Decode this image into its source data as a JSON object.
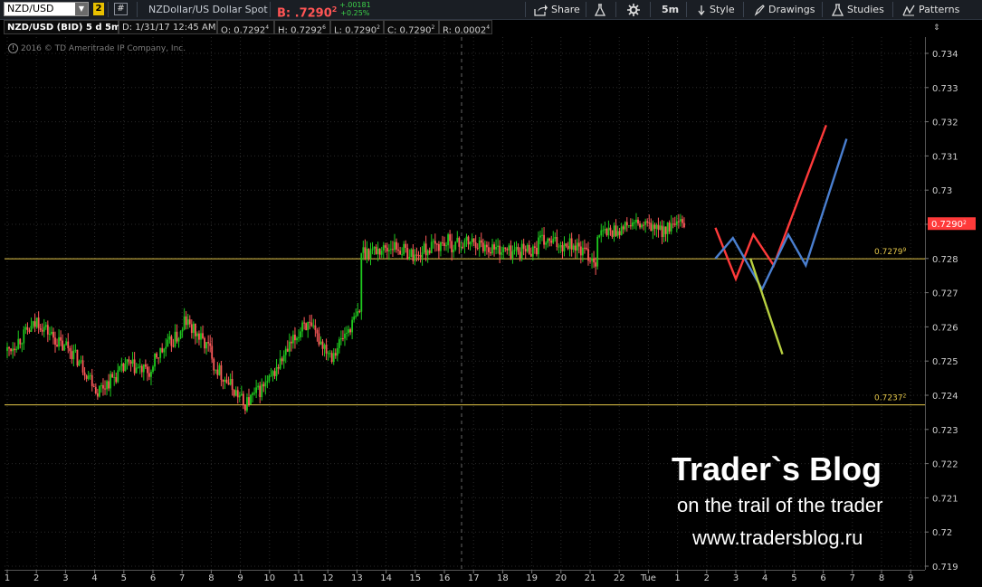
{
  "toolbar": {
    "symbol": "NZD/USD",
    "link_number": "2",
    "hash_label": "#",
    "description": "NZDollar/US Dollar Spot",
    "bid_label": "B: .7290",
    "bid_sup": "2",
    "change_abs": "+.00181",
    "change_pct": "+0.25%",
    "share_label": "Share",
    "timeframe": "5m",
    "style_label": "Style",
    "drawings_label": "Drawings",
    "studies_label": "Studies",
    "patterns_label": "Patterns"
  },
  "infobar": {
    "title": "NZD/USD (BID) 5 d 5m",
    "date": "D: 1/31/17 12:45 AM",
    "open": "O: 0.7292",
    "open_sup": "4",
    "high": "H: 0.7292",
    "high_sup": "6",
    "low": "L: 0.7290",
    "low_sup": "2",
    "close": "C: 0.7290",
    "close_sup": "2",
    "range": "R: 0.0002",
    "range_sup": "4"
  },
  "copyright": "2016 © TD Ameritrade IP Company, Inc.",
  "watermark": {
    "title": "Trader`s Blog",
    "subtitle": "on the trail of the trader",
    "url": "www.tradersblog.ru"
  },
  "colors": {
    "up": "#1ec81e",
    "down": "#ff5a5a",
    "level": "#e6c84a",
    "path_red": "#ff3a3a",
    "path_blue": "#4a7fd0",
    "path_green": "#b8d040",
    "price_tag": "#ff3a3a"
  },
  "chart_data": {
    "type": "candlestick",
    "ylim": [
      0.719,
      0.7345
    ],
    "y_ticks": [
      "0.734",
      "0.733",
      "0.732",
      "0.731",
      "0.73",
      "0.729",
      "0.728",
      "0.727",
      "0.726",
      "0.725",
      "0.724",
      "0.723",
      "0.722",
      "0.721",
      "0.72",
      "0.719"
    ],
    "y_tick_values": [
      0.734,
      0.733,
      0.732,
      0.731,
      0.73,
      0.729,
      0.728,
      0.727,
      0.726,
      0.725,
      0.724,
      0.723,
      0.722,
      0.721,
      0.72,
      0.719
    ],
    "x_ticks": [
      "1",
      "2",
      "3",
      "4",
      "5",
      "6",
      "7",
      "8",
      "9",
      "10",
      "11",
      "12",
      "13",
      "14",
      "15",
      "16",
      "17",
      "18",
      "19",
      "20",
      "21",
      "22",
      "Tue",
      "1",
      "2",
      "3",
      "4",
      "5",
      "6",
      "7",
      "8",
      "9"
    ],
    "current_price_label": "0.7290",
    "current_price_sup": "2",
    "current_price": 0.72902,
    "levels": [
      {
        "label": "0.7279",
        "sup": "9",
        "value": 0.72799
      },
      {
        "label": "0.7237",
        "sup": "2",
        "value": 0.72372
      }
    ],
    "price_path": [
      [
        0.7253,
        0.7261
      ],
      [
        0.7262,
        0.7253
      ],
      [
        0.7255,
        0.7243
      ],
      [
        0.7241,
        0.7248
      ],
      [
        0.7249,
        0.7246
      ],
      [
        0.7251,
        0.7259
      ],
      [
        0.7262,
        0.7252
      ],
      [
        0.7249,
        0.7238
      ],
      [
        0.7237,
        0.7245
      ],
      [
        0.7246,
        0.726
      ],
      [
        0.7262,
        0.7252
      ],
      [
        0.7252,
        0.7265
      ],
      [
        0.7282,
        0.7283
      ],
      [
        0.7284,
        0.728
      ],
      [
        0.7282,
        0.7285
      ],
      [
        0.7284,
        0.7285
      ],
      [
        0.7284,
        0.7282
      ],
      [
        0.7282,
        0.7283
      ],
      [
        0.7285,
        0.7284
      ],
      [
        0.7285,
        0.7279
      ],
      [
        0.7287,
        0.7289
      ],
      [
        0.729,
        0.7289
      ],
      [
        0.7288,
        0.729
      ]
    ],
    "drawn_paths": [
      {
        "color": "path_red",
        "points": [
          [
            24.3,
            0.7289
          ],
          [
            25.0,
            0.7274
          ],
          [
            25.6,
            0.7287
          ],
          [
            26.3,
            0.7278
          ],
          [
            28.1,
            0.7319
          ]
        ]
      },
      {
        "color": "path_blue",
        "points": [
          [
            24.3,
            0.728
          ],
          [
            24.9,
            0.7286
          ],
          [
            25.9,
            0.7271
          ],
          [
            26.8,
            0.7287
          ],
          [
            27.4,
            0.7278
          ],
          [
            28.8,
            0.7315
          ]
        ]
      },
      {
        "color": "path_green",
        "points": [
          [
            25.5,
            0.728
          ],
          [
            26.6,
            0.7252
          ]
        ]
      }
    ]
  }
}
